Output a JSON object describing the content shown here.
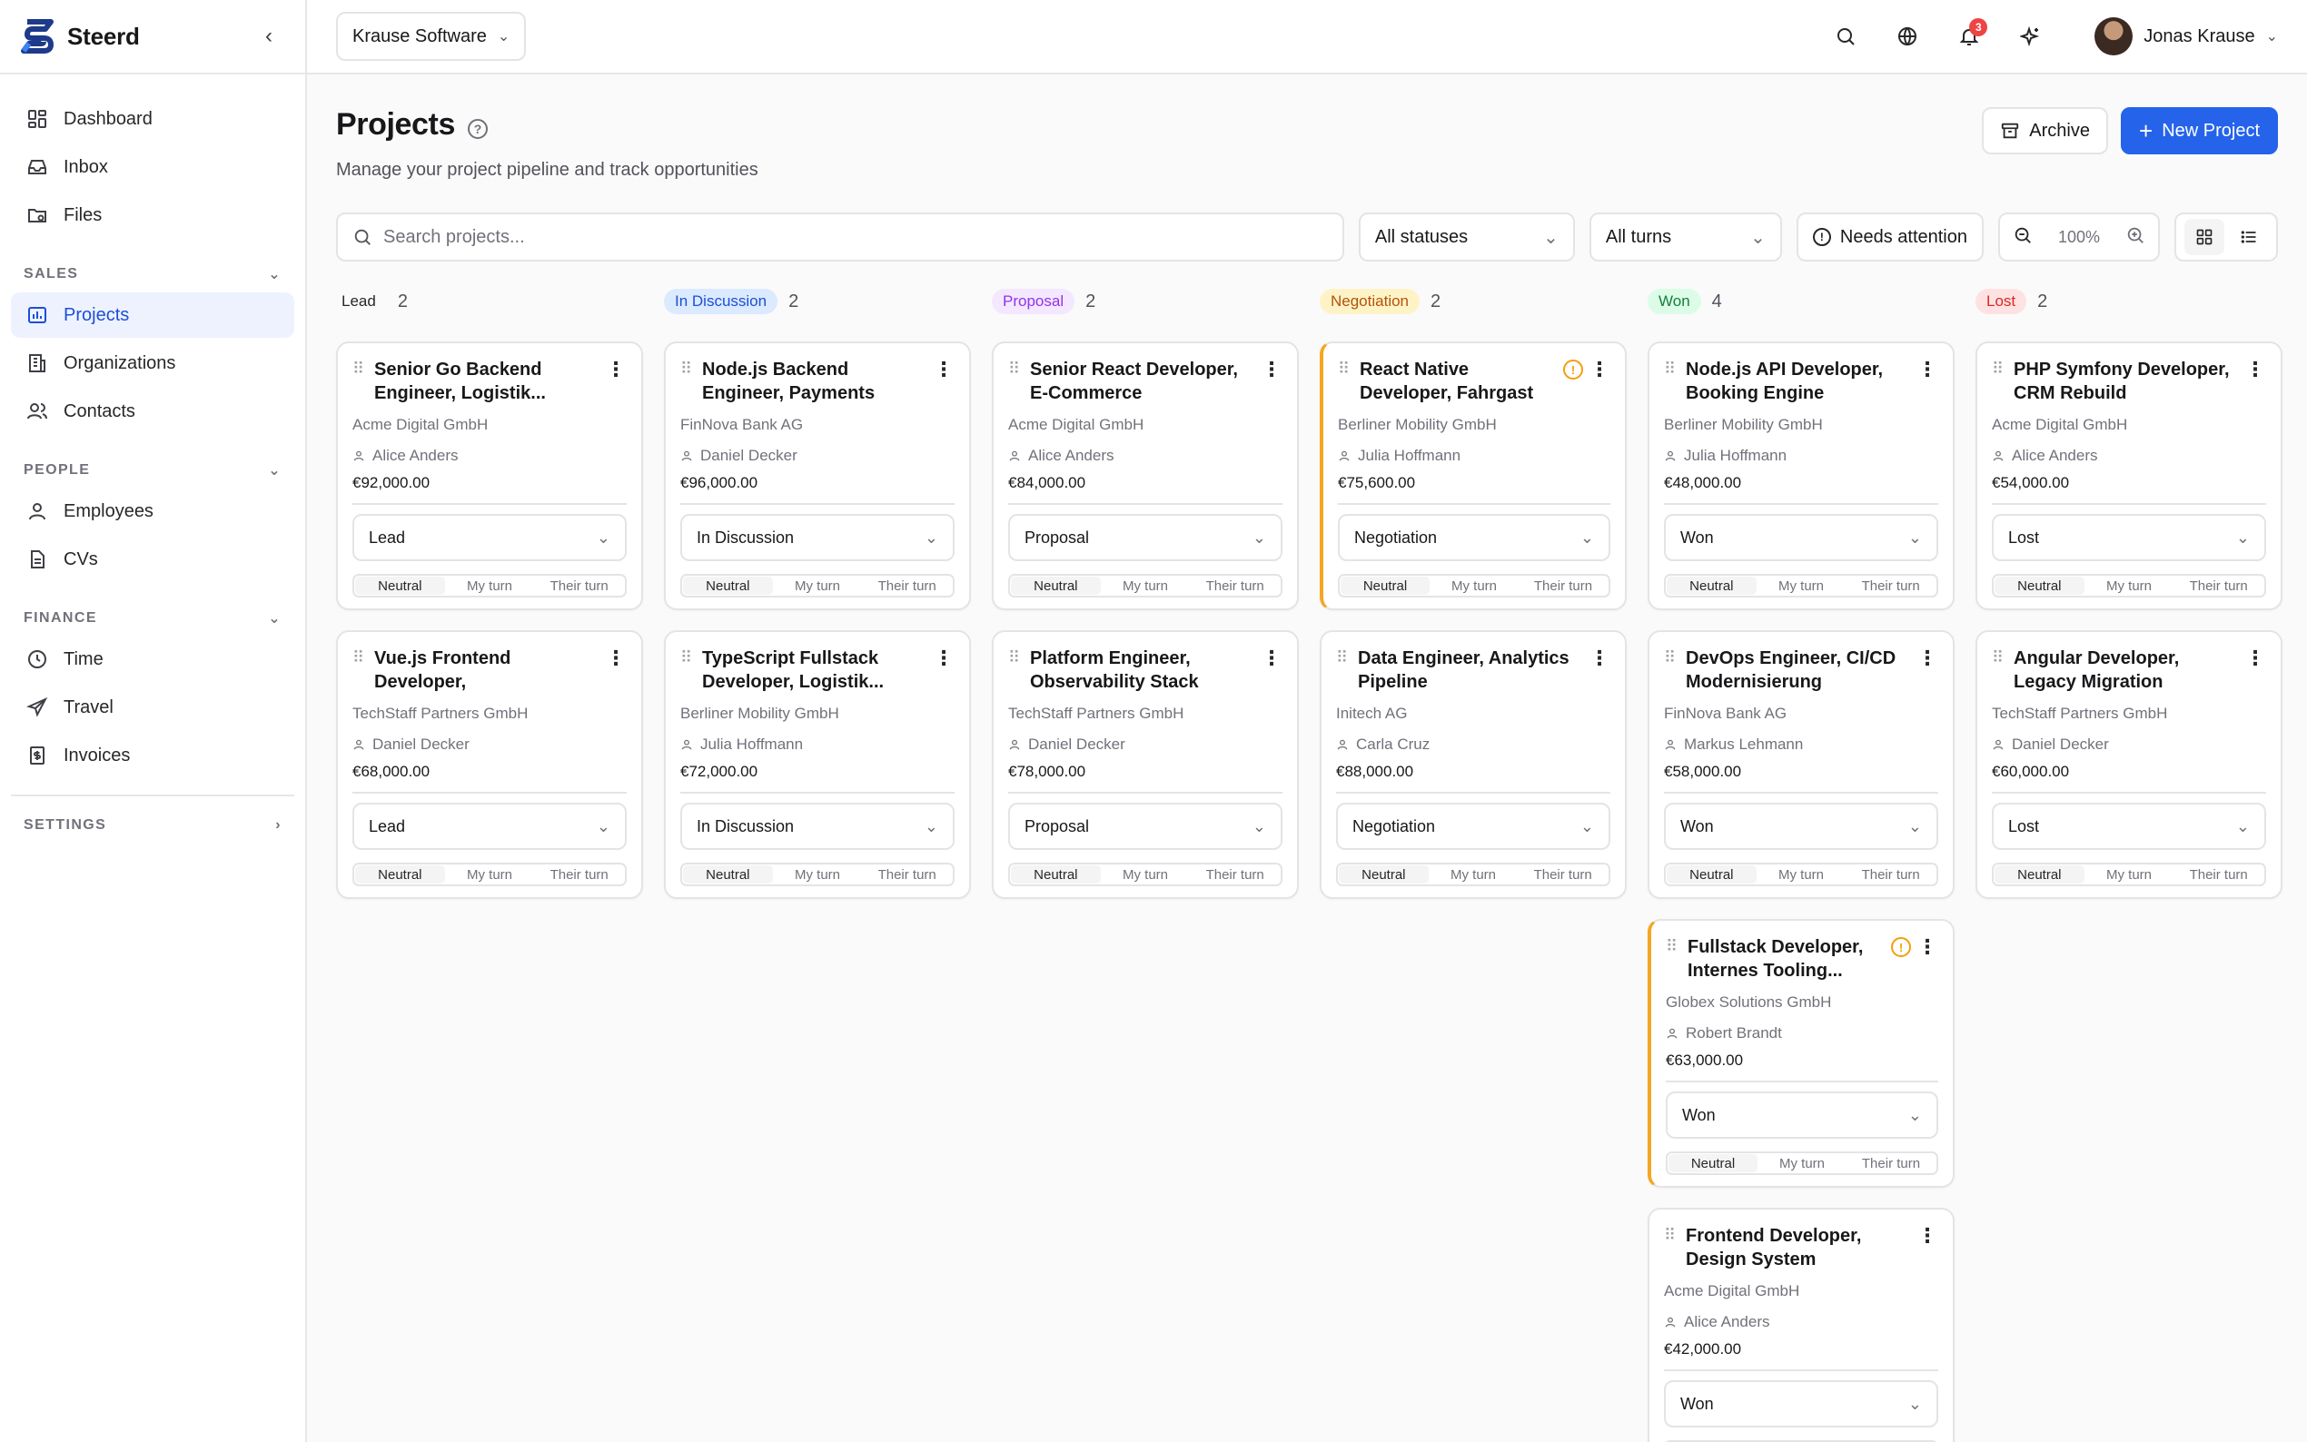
{
  "brand": {
    "name": "Steerd"
  },
  "sidebar": {
    "top": [
      {
        "label": "Dashboard",
        "icon": "dashboard-icon"
      },
      {
        "label": "Inbox",
        "icon": "inbox-icon"
      },
      {
        "label": "Files",
        "icon": "files-icon"
      }
    ],
    "sales_label": "SALES",
    "sales": [
      {
        "label": "Projects",
        "icon": "projects-icon",
        "active": true
      },
      {
        "label": "Organizations",
        "icon": "building-icon"
      },
      {
        "label": "Contacts",
        "icon": "contacts-icon"
      }
    ],
    "people_label": "PEOPLE",
    "people": [
      {
        "label": "Employees",
        "icon": "user-icon"
      },
      {
        "label": "CVs",
        "icon": "document-icon"
      }
    ],
    "finance_label": "FINANCE",
    "finance": [
      {
        "label": "Time",
        "icon": "clock-icon"
      },
      {
        "label": "Travel",
        "icon": "plane-icon"
      },
      {
        "label": "Invoices",
        "icon": "invoice-icon"
      }
    ],
    "settings_label": "SETTINGS"
  },
  "topbar": {
    "org": "Krause Software",
    "notifications": "3",
    "user": "Jonas Krause"
  },
  "page": {
    "title": "Projects",
    "subtitle": "Manage your project pipeline and track opportunities",
    "archive": "Archive",
    "new_project": "New Project"
  },
  "filters": {
    "search_placeholder": "Search projects...",
    "status": "All statuses",
    "turns": "All turns",
    "attention": "Needs attention",
    "zoom": "100%"
  },
  "turn_labels": [
    "Neutral",
    "My turn",
    "Their turn"
  ],
  "columns": [
    {
      "name": "Lead",
      "count": "2",
      "bg": "transparent",
      "fg": "#27272a",
      "cards": [
        {
          "title": "Senior Go Backend Engineer, Logistik...",
          "org": "Acme Digital GmbH",
          "contact": "Alice Anders",
          "value": "€92,000.00",
          "status": "Lead",
          "attention": false
        },
        {
          "title": "Vue.js Frontend Developer, Versicherungsportal",
          "org": "TechStaff Partners GmbH",
          "contact": "Daniel Decker",
          "value": "€68,000.00",
          "status": "Lead",
          "attention": false
        }
      ]
    },
    {
      "name": "In Discussion",
      "count": "2",
      "bg": "#dbeafe",
      "fg": "#1d4ed8",
      "cards": [
        {
          "title": "Node.js Backend Engineer, Payments Plattform",
          "org": "FinNova Bank AG",
          "contact": "Daniel Decker",
          "value": "€96,000.00",
          "status": "In Discussion",
          "attention": false
        },
        {
          "title": "TypeScript Fullstack Developer, Logistik...",
          "org": "Berliner Mobility GmbH",
          "contact": "Julia Hoffmann",
          "value": "€72,000.00",
          "status": "In Discussion",
          "attention": false
        }
      ]
    },
    {
      "name": "Proposal",
      "count": "2",
      "bg": "#f3e8ff",
      "fg": "#9333ea",
      "cards": [
        {
          "title": "Senior React Developer, E-Commerce Replatforming",
          "org": "Acme Digital GmbH",
          "contact": "Alice Anders",
          "value": "€84,000.00",
          "status": "Proposal",
          "attention": false
        },
        {
          "title": "Platform Engineer, Observability Stack",
          "org": "TechStaff Partners GmbH",
          "contact": "Daniel Decker",
          "value": "€78,000.00",
          "status": "Proposal",
          "attention": false
        }
      ]
    },
    {
      "name": "Negotiation",
      "count": "2",
      "bg": "#fef3c7",
      "fg": "#b45309",
      "cards": [
        {
          "title": "React Native Developer, Fahrgast App",
          "org": "Berliner Mobility GmbH",
          "contact": "Julia Hoffmann",
          "value": "€75,600.00",
          "status": "Negotiation",
          "attention": true
        },
        {
          "title": "Data Engineer, Analytics Pipeline",
          "org": "Initech AG",
          "contact": "Carla Cruz",
          "value": "€88,000.00",
          "status": "Negotiation",
          "attention": false
        }
      ]
    },
    {
      "name": "Won",
      "count": "4",
      "bg": "#dcfce7",
      "fg": "#15803d",
      "cards": [
        {
          "title": "Node.js API Developer, Booking Engine",
          "org": "Berliner Mobility GmbH",
          "contact": "Julia Hoffmann",
          "value": "€48,000.00",
          "status": "Won",
          "attention": false
        },
        {
          "title": "DevOps Engineer, CI/CD Modernisierung",
          "org": "FinNova Bank AG",
          "contact": "Markus Lehmann",
          "value": "€58,000.00",
          "status": "Won",
          "attention": false
        },
        {
          "title": "Fullstack Developer, Internes Tooling...",
          "org": "Globex Solutions GmbH",
          "contact": "Robert Brandt",
          "value": "€63,000.00",
          "status": "Won",
          "attention": true
        },
        {
          "title": "Frontend Developer, Design System",
          "org": "Acme Digital GmbH",
          "contact": "Alice Anders",
          "value": "€42,000.00",
          "status": "Won",
          "attention": false
        }
      ]
    },
    {
      "name": "Lost",
      "count": "2",
      "bg": "#fee2e2",
      "fg": "#dc2626",
      "cards": [
        {
          "title": "PHP Symfony Developer, CRM Rebuild",
          "org": "Acme Digital GmbH",
          "contact": "Alice Anders",
          "value": "€54,000.00",
          "status": "Lost",
          "attention": false
        },
        {
          "title": "Angular Developer, Legacy Migration",
          "org": "TechStaff Partners GmbH",
          "contact": "Daniel Decker",
          "value": "€60,000.00",
          "status": "Lost",
          "attention": false
        }
      ]
    }
  ]
}
